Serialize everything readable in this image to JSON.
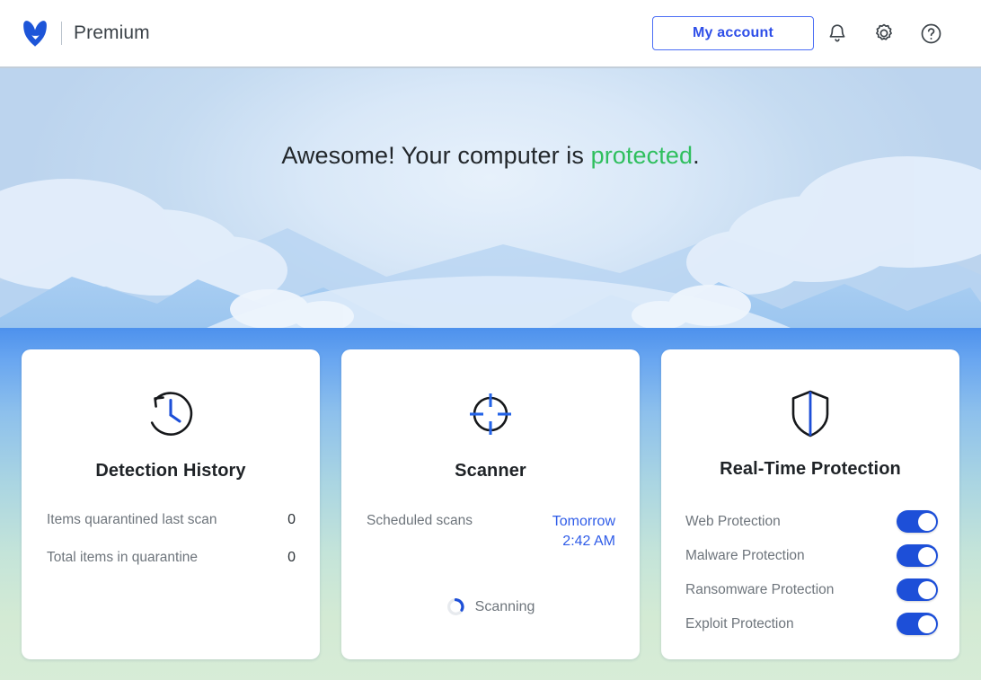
{
  "header": {
    "logo_icon": "malwarebytes-logo",
    "product_name": "Premium",
    "account_button": "My account",
    "icons": [
      {
        "name": "notifications-bell-icon",
        "label": "Notifications"
      },
      {
        "name": "settings-gear-icon",
        "label": "Settings"
      },
      {
        "name": "help-question-icon",
        "label": "Help"
      }
    ],
    "accent_color": "#2f4fe8"
  },
  "hero": {
    "status_prefix": "Awesome! Your computer is ",
    "status_highlight": "protected",
    "status_suffix": ".",
    "highlight_color": "#2fbf5e"
  },
  "cards": {
    "detection_history": {
      "icon": "clock-history-icon",
      "title": "Detection History",
      "stats": [
        {
          "label": "Items quarantined last scan",
          "value": "0"
        },
        {
          "label": "Total items in quarantine",
          "value": "0"
        }
      ]
    },
    "scanner": {
      "icon": "crosshair-scan-icon",
      "title": "Scanner",
      "scheduled_label": "Scheduled scans",
      "scheduled_day": "Tomorrow",
      "scheduled_time": "2:42 AM",
      "scheduled_color": "#2f5ce8",
      "status_icon": "loading-spinner-icon",
      "status_text": "Scanning"
    },
    "real_time_protection": {
      "icon": "shield-icon",
      "title": "Real-Time Protection",
      "toggles": [
        {
          "label": "Web Protection",
          "on": true
        },
        {
          "label": "Malware Protection",
          "on": true
        },
        {
          "label": "Ransomware Protection",
          "on": true
        },
        {
          "label": "Exploit Protection",
          "on": true
        }
      ],
      "toggle_on_color": "#1d4fd8"
    }
  }
}
